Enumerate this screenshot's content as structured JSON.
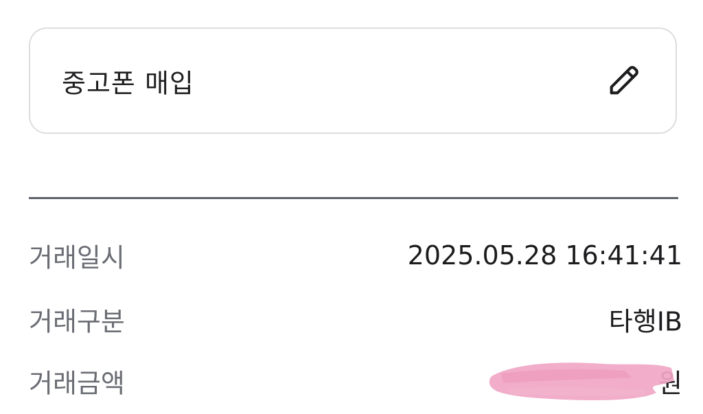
{
  "memo": {
    "text": "중고폰 매입",
    "edit_icon": "pencil-icon"
  },
  "details": {
    "date_label": "거래일시",
    "date_value": "2025.05.28 16:41:41",
    "type_label": "거래구분",
    "type_value": "타행IB",
    "amount_label": "거래금액",
    "amount_unit": "원",
    "amount_redacted": true
  },
  "colors": {
    "divider": "#5f6169",
    "card_border": "#dcdde0",
    "label": "#6b6d74",
    "redaction": "#f0a6c4"
  }
}
